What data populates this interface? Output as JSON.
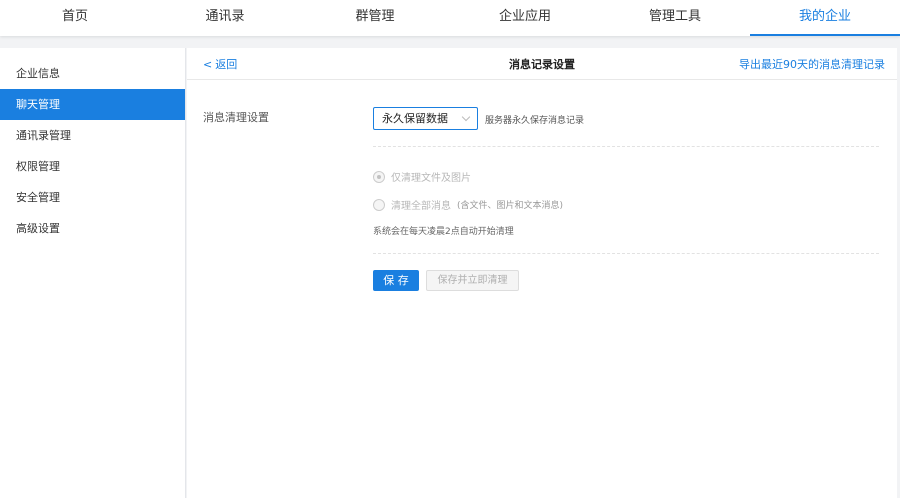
{
  "topnav": {
    "tabs": [
      "首页",
      "通讯录",
      "群管理",
      "企业应用",
      "管理工具",
      "我的企业"
    ],
    "active_index": 5
  },
  "sidebar": {
    "items": [
      "企业信息",
      "聊天管理",
      "通讯录管理",
      "权限管理",
      "安全管理",
      "高级设置"
    ],
    "active_index": 1
  },
  "header": {
    "back_label": "返回",
    "title": "消息记录设置",
    "export_label": "导出最近90天的消息清理记录"
  },
  "form": {
    "label": "消息清理设置",
    "select_value": "永久保留数据",
    "select_hint": "服务器永久保存消息记录",
    "options": [
      {
        "label": "仅清理文件及图片",
        "note": "",
        "checked": true,
        "disabled": true
      },
      {
        "label": "清理全部消息",
        "note": "(含文件、图片和文本消息)",
        "checked": false,
        "disabled": true
      }
    ],
    "system_note": "系统会在每天凌晨2点自动开始清理"
  },
  "buttons": {
    "save": "保 存",
    "save_and_clear": "保存并立即清理"
  },
  "colors": {
    "accent": "#1a7fe0",
    "background": "#f2f3f5"
  }
}
